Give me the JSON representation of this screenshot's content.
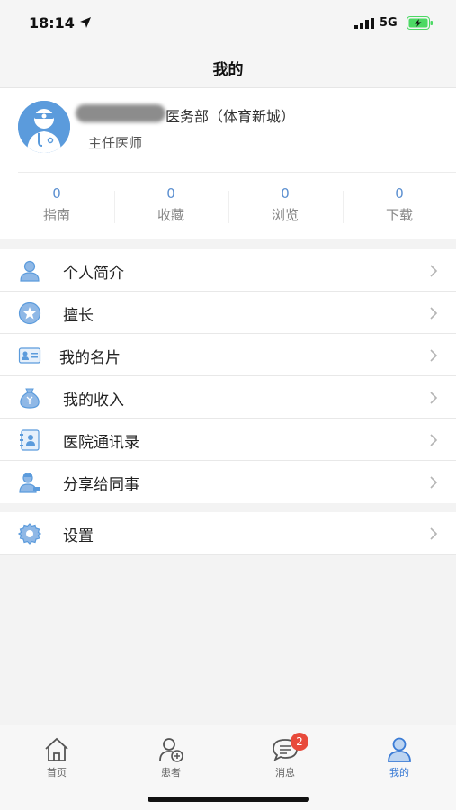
{
  "status_bar": {
    "time": "18:14",
    "network": "5G"
  },
  "nav": {
    "title": "我的"
  },
  "profile": {
    "department": "医务部（体育新城）",
    "title": "主任医师"
  },
  "stats": [
    {
      "value": "0",
      "label": "指南"
    },
    {
      "value": "0",
      "label": "收藏"
    },
    {
      "value": "0",
      "label": "浏览"
    },
    {
      "value": "0",
      "label": "下载"
    }
  ],
  "menu": [
    {
      "label": "个人简介",
      "icon": "person-icon"
    },
    {
      "label": "擅长",
      "icon": "star-badge-icon"
    },
    {
      "label": "我的名片",
      "icon": "id-card-icon"
    },
    {
      "label": "我的收入",
      "icon": "money-bag-icon"
    },
    {
      "label": "医院通讯录",
      "icon": "contacts-book-icon"
    },
    {
      "label": "分享给同事",
      "icon": "doctor-share-icon"
    }
  ],
  "settings": {
    "label": "设置",
    "icon": "gear-icon"
  },
  "tabs": [
    {
      "label": "首页",
      "icon": "home-icon"
    },
    {
      "label": "患者",
      "icon": "add-patient-icon"
    },
    {
      "label": "消息",
      "icon": "message-icon",
      "badge": "2"
    },
    {
      "label": "我的",
      "icon": "profile-icon",
      "active": true
    }
  ],
  "colors": {
    "accent": "#3a7bd5",
    "icon_blue": "#5b9bdc",
    "badge_red": "#e84a3b",
    "stat_number": "#5b8fd0"
  }
}
